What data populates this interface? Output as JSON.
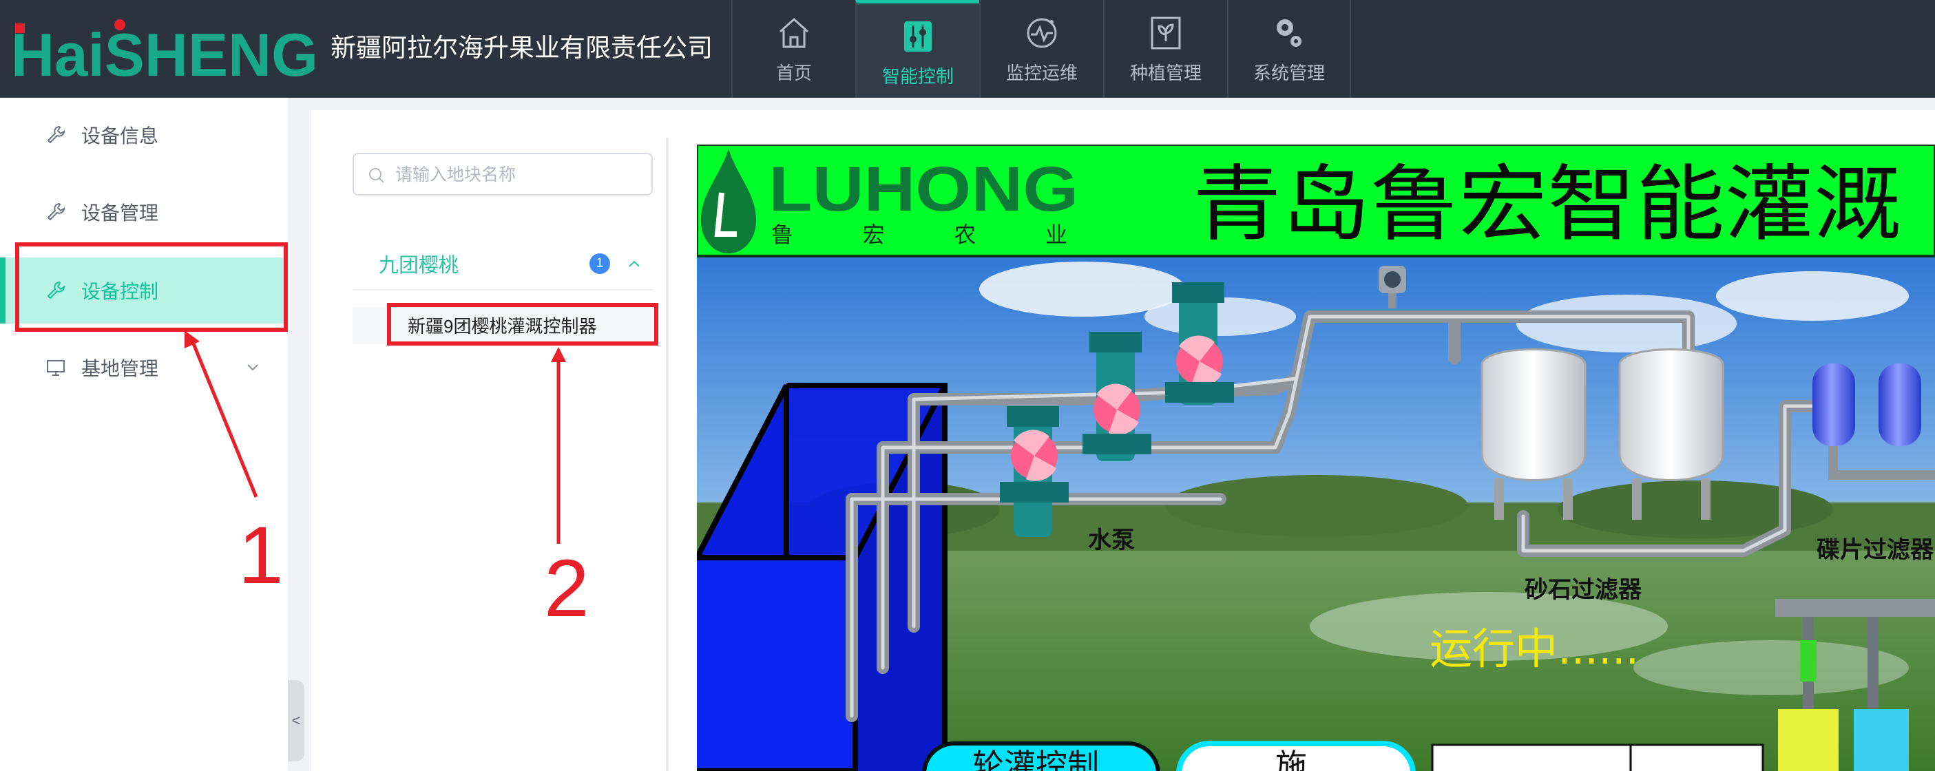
{
  "header": {
    "logo_text": "HaiSHENG",
    "company_name": "新疆阿拉尔海升果业有限责任公司",
    "nav": [
      {
        "label": "首页",
        "icon": "home-icon",
        "active": false
      },
      {
        "label": "智能控制",
        "icon": "control-sliders-icon",
        "active": true
      },
      {
        "label": "监控运维",
        "icon": "monitor-gauge-icon",
        "active": false
      },
      {
        "label": "种植管理",
        "icon": "planting-icon",
        "active": false
      },
      {
        "label": "系统管理",
        "icon": "gears-icon",
        "active": false
      }
    ]
  },
  "sidebar": {
    "items": [
      {
        "label": "设备信息",
        "icon": "wrench-icon",
        "active": false
      },
      {
        "label": "设备管理",
        "icon": "wrench-icon",
        "active": false
      },
      {
        "label": "设备控制",
        "icon": "wrench-icon",
        "active": true
      },
      {
        "label": "基地管理",
        "icon": "monitor-icon",
        "active": false
      }
    ],
    "collapse_glyph": "<"
  },
  "tree": {
    "search_placeholder": "请输入地块名称",
    "group": {
      "label": "九团樱桃",
      "count": "1"
    },
    "item": {
      "label": "新疆9团樱桃灌溉控制器"
    }
  },
  "scada": {
    "brand": "LUHONG",
    "brand_sub": "鲁 宏 农 业",
    "title": "青岛鲁宏智能灌溉",
    "labels": {
      "pump": "水泵",
      "sand_filter": "砂石过滤器",
      "disc_filter": "碟片过滤器"
    },
    "status_text": "运行中......",
    "button_left": "轮灌控制",
    "button_right": "施"
  },
  "annotations": {
    "one": "1",
    "two": "2"
  },
  "colors": {
    "accent": "#14c29a",
    "header_bg": "#2b333e",
    "annotation": "#e7202a",
    "banner_green": "#00ff2a",
    "tank_blue": "#0a1ee0"
  }
}
